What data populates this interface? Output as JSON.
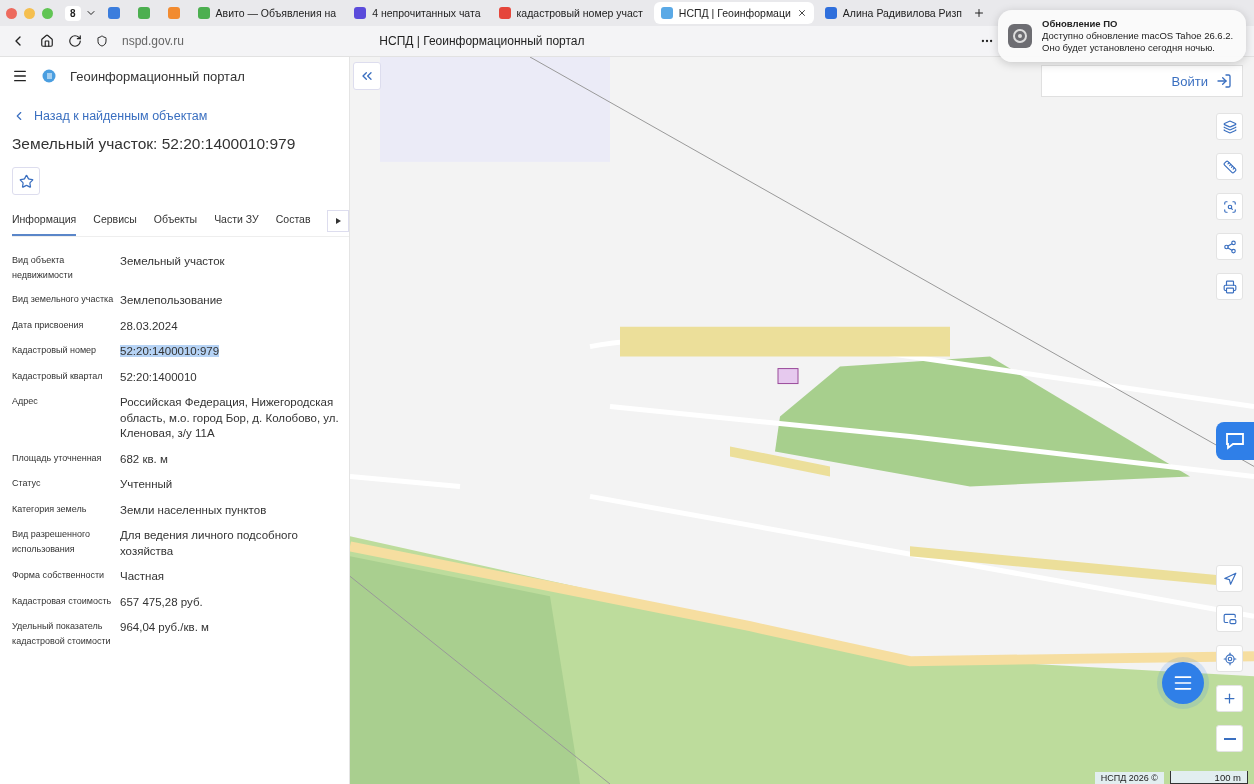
{
  "browser": {
    "tab_count": "8",
    "tabs": [
      {
        "kind": "pinned",
        "color": "#3b7ddd",
        "selected": false
      },
      {
        "kind": "pinned",
        "color": "#4caf50",
        "selected": false
      },
      {
        "kind": "pinned",
        "color": "#f28b30",
        "selected": false
      },
      {
        "kind": "page",
        "color": "#4caf50",
        "title": "Авито — Объявления на",
        "selected": false
      },
      {
        "kind": "page",
        "color": "#5b4bdb",
        "title": "4 непрочитанных чата",
        "selected": false
      },
      {
        "kind": "page",
        "color": "#e5463b",
        "title": "кадастровый номер участ",
        "selected": false
      },
      {
        "kind": "page",
        "color": "#5aa9e6",
        "title": "НСПД | Геоинформаци",
        "selected": true
      },
      {
        "kind": "page",
        "color": "#2f6fdc",
        "title": "Алина Радивилова Ризп",
        "selected": false
      }
    ],
    "url": "nspd.gov.ru",
    "page_title": "НСПД | Геоинформационный портал"
  },
  "notification": {
    "title": "Обновление ПО",
    "body": "Доступно обновление macOS Tahoe 26.6.2.\nОно будет установлено сегодня ночью."
  },
  "sidebar": {
    "app_title": "Геоинформационный портал",
    "back_link": "Назад к найденным объектам",
    "heading": "Земельный участок: 52:20:1400010:979",
    "tabs": [
      {
        "label": "Информация",
        "selected": true
      },
      {
        "label": "Сервисы",
        "selected": false
      },
      {
        "label": "Объекты",
        "selected": false
      },
      {
        "label": "Части ЗУ",
        "selected": false
      },
      {
        "label": "Состав",
        "selected": false
      }
    ],
    "fields": [
      {
        "label": "Вид объекта недвижимости",
        "value": "Земельный участок",
        "highlighted": false
      },
      {
        "label": "Вид земельного участка",
        "value": "Землепользование",
        "highlighted": false
      },
      {
        "label": "Дата присвоения",
        "value": "28.03.2024",
        "highlighted": false
      },
      {
        "label": "Кадастровый номер",
        "value": "52:20:1400010:979",
        "highlighted": true
      },
      {
        "label": "Кадастровый квартал",
        "value": "52:20:1400010",
        "highlighted": false
      },
      {
        "label": "Адрес",
        "value": "Российская Федерация, Нижегородская область, м.о. город Бор, д. Колобово, ул. Кленовая, з/у 11А",
        "highlighted": false
      },
      {
        "label": "Площадь уточненная",
        "value": "682 кв. м",
        "highlighted": false
      },
      {
        "label": "Статус",
        "value": "Учтенный",
        "highlighted": false
      },
      {
        "label": "Категория земель",
        "value": "Земли населенных пунктов",
        "highlighted": false
      },
      {
        "label": "Вид разрешенного использования",
        "value": "Для ведения личного подсобного хозяйства",
        "highlighted": false
      },
      {
        "label": "Форма собственности",
        "value": "Частная",
        "highlighted": false
      },
      {
        "label": "Кадастровая стоимость",
        "value": "657 475,28 руб.",
        "highlighted": false
      },
      {
        "label": "Удельный показатель кадастровой стоимости",
        "value": "964,04 руб./кв. м",
        "highlighted": false
      }
    ]
  },
  "map": {
    "kind": "picture",
    "login_label": "Войти",
    "attribution": "НСПД 2026 ©",
    "scale": "100 m"
  }
}
